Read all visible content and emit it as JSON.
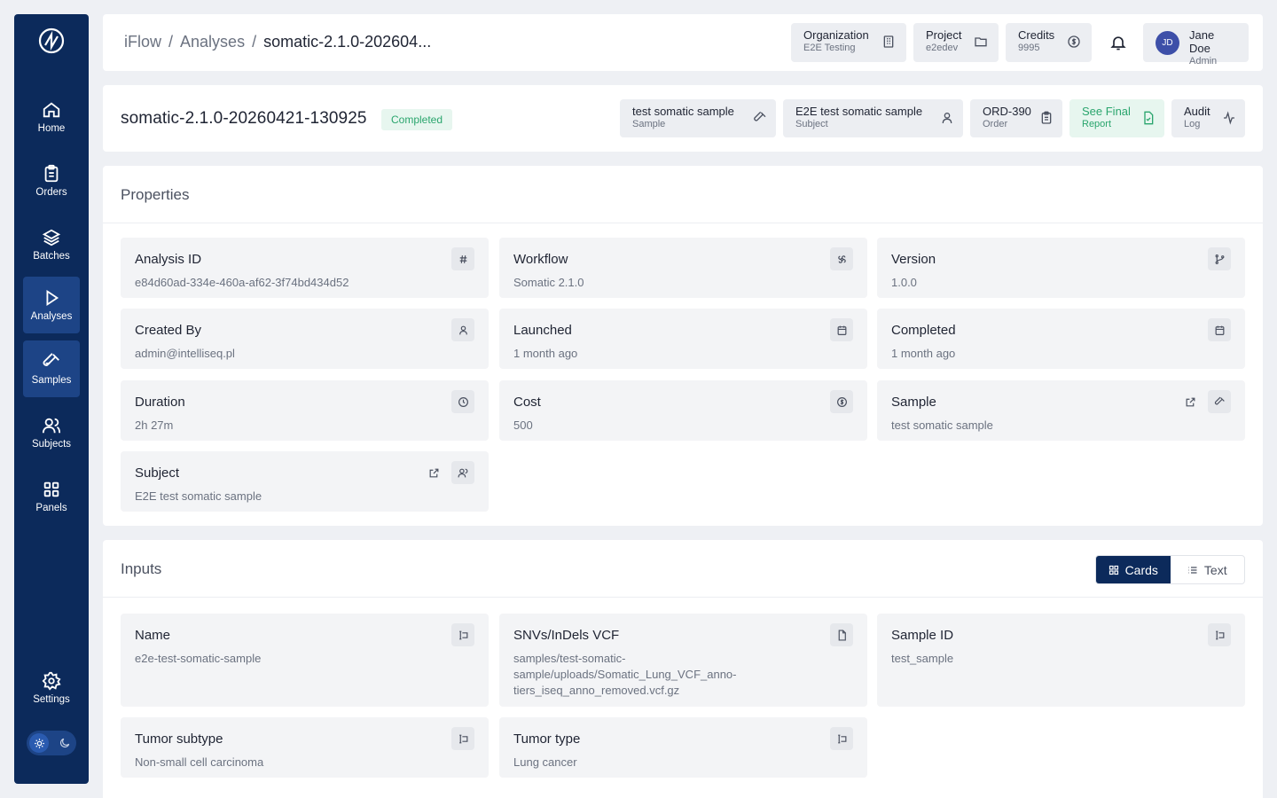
{
  "sidebar": {
    "items": [
      {
        "label": "Home",
        "icon": "home-icon"
      },
      {
        "label": "Orders",
        "icon": "clipboard-icon"
      },
      {
        "label": "Batches",
        "icon": "layers-icon"
      },
      {
        "label": "Analyses",
        "icon": "play-icon"
      },
      {
        "label": "Samples",
        "icon": "test-tube-icon"
      },
      {
        "label": "Subjects",
        "icon": "users-icon"
      },
      {
        "label": "Panels",
        "icon": "grid-icon"
      }
    ],
    "settings_label": "Settings",
    "accent": "#0c2a5b"
  },
  "header": {
    "breadcrumb": [
      "iFlow",
      "Analyses",
      "somatic-2.1.0-202604..."
    ],
    "chips": [
      {
        "title": "Organization",
        "sub": "E2E Testing",
        "icon": "building-icon"
      },
      {
        "title": "Project",
        "sub": "e2edev",
        "icon": "folder-icon"
      },
      {
        "title": "Credits",
        "sub": "9995",
        "icon": "coin-icon"
      }
    ],
    "user": {
      "initials": "JD",
      "name": "Jane Doe",
      "role": "Admin"
    }
  },
  "analysis": {
    "title": "somatic-2.1.0-20260421-130925",
    "status": "Completed",
    "status_color": "#2aa56d",
    "actions": [
      {
        "title": "test somatic sample",
        "sub": "Sample",
        "icon": "test-tube-icon"
      },
      {
        "title": "E2E test somatic sample",
        "sub": "Subject",
        "icon": "user-icon"
      },
      {
        "title": "ORD-390",
        "sub": "Order",
        "icon": "clipboard-icon"
      },
      {
        "title": "See Final",
        "sub": "Report",
        "icon": "file-check-icon"
      },
      {
        "title": "Audit",
        "sub": "Log",
        "icon": "activity-icon"
      }
    ]
  },
  "properties": {
    "title": "Properties",
    "items": [
      {
        "label": "Analysis ID",
        "value": "e84d60ad-334e-460a-af62-3f74bd434d52",
        "icon": "hash-icon"
      },
      {
        "label": "Workflow",
        "value": "Somatic 2.1.0",
        "icon": "workflow-icon"
      },
      {
        "label": "Version",
        "value": "1.0.0",
        "icon": "git-branch-icon"
      },
      {
        "label": "Created By",
        "value": "admin@intelliseq.pl",
        "icon": "user-icon"
      },
      {
        "label": "Launched",
        "value": "1 month ago",
        "icon": "calendar-icon"
      },
      {
        "label": "Completed",
        "value": "1 month ago",
        "icon": "calendar-check-icon"
      },
      {
        "label": "Duration",
        "value": "2h 27m",
        "icon": "clock-icon"
      },
      {
        "label": "Cost",
        "value": "500",
        "icon": "coin-icon"
      },
      {
        "label": "Sample",
        "value": "test somatic sample",
        "icon": "test-tube-icon"
      },
      {
        "label": "Subject",
        "value": "E2E test somatic sample",
        "icon": "users-icon"
      }
    ]
  },
  "inputs": {
    "title": "Inputs",
    "view_options": [
      "Cards",
      "Text"
    ],
    "items": [
      {
        "label": "Name",
        "value": "e2e-test-somatic-sample",
        "icon": "text-field-icon"
      },
      {
        "label": "SNVs/InDels VCF",
        "value": "samples/test-somatic-sample/uploads/Somatic_Lung_VCF_anno-tiers_iseq_anno_removed.vcf.gz",
        "icon": "file-icon"
      },
      {
        "label": "Sample ID",
        "value": "test_sample",
        "icon": "text-field-icon"
      },
      {
        "label": "Tumor subtype",
        "value": "Non-small cell carcinoma",
        "icon": "text-field-icon"
      },
      {
        "label": "Tumor type",
        "value": "Lung cancer",
        "icon": "text-field-icon"
      }
    ]
  }
}
